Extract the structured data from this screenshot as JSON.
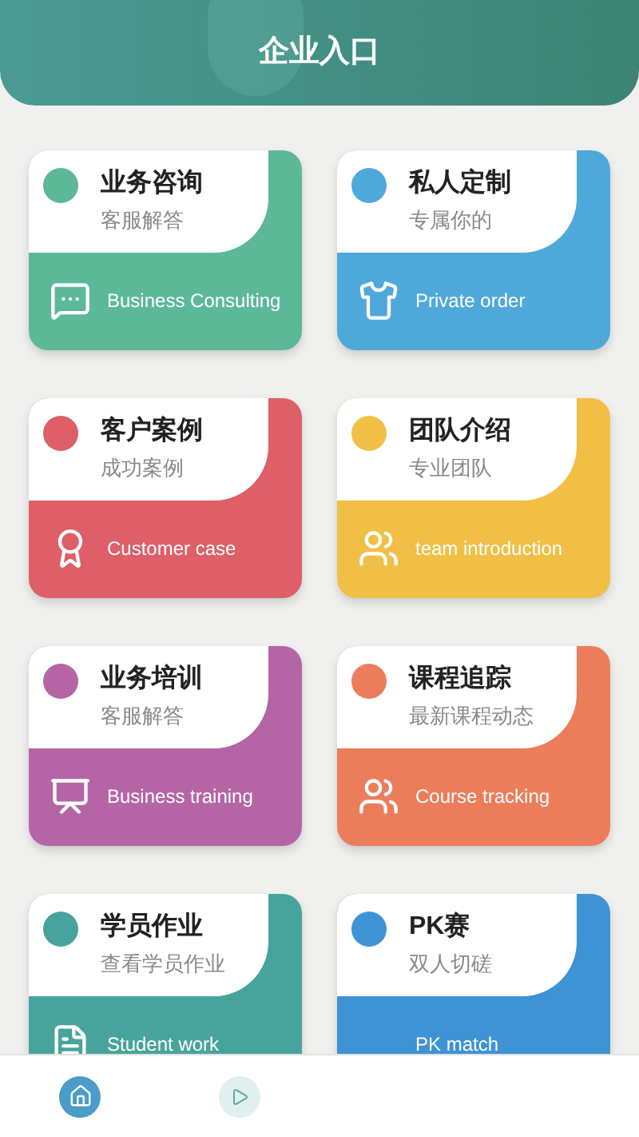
{
  "header": {
    "title": "企业入口"
  },
  "cards": [
    {
      "title": "业务咨询",
      "subtitle": "客服解答",
      "label": "Business Consulting",
      "color": "#5cb998",
      "kind": "chat"
    },
    {
      "title": "私人定制",
      "subtitle": "专属你的",
      "label": "Private order",
      "color": "#4ea9da",
      "kind": "shirt"
    },
    {
      "title": "客户案例",
      "subtitle": "成功案例",
      "label": "Customer case",
      "color": "#de5f68",
      "kind": "award"
    },
    {
      "title": "团队介绍",
      "subtitle": "专业团队",
      "label": "team introduction",
      "color": "#f1bf45",
      "kind": "people"
    },
    {
      "title": "业务培训",
      "subtitle": "客服解答",
      "label": "Business training",
      "color": "#b565a6",
      "kind": "board"
    },
    {
      "title": "课程追踪",
      "subtitle": "最新课程动态",
      "label": "Course tracking",
      "color": "#ec7d5b",
      "kind": "people"
    },
    {
      "title": "学员作业",
      "subtitle": "查看学员作业",
      "label": "Student work",
      "color": "#47a49c",
      "kind": "doc"
    },
    {
      "title": "PK赛",
      "subtitle": "双人切磋",
      "label": "PK match",
      "color": "#3d93d4",
      "kind": "plain"
    }
  ],
  "nav": [
    {
      "kind": "home",
      "selected": true
    },
    {
      "kind": "video",
      "selected": false
    }
  ]
}
